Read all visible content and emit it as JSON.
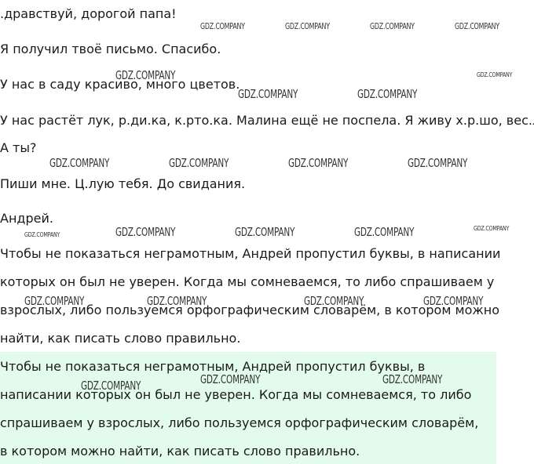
{
  "letter": {
    "greeting": ".дравствуй, дорогой папа!",
    "line1": "Я получил твоё письмо. Спасибо.",
    "line2": "У нас в саду красиво, много цветов.",
    "line3": "У нас растёт лук, р.ди.ка, к.рто.ка. Малина ещё не поспела. Я живу х.р.шо, вес.л..",
    "line4": "А ты?",
    "line5": "Пиши мне. Ц.лую тебя. До свидания.",
    "signature": "Андрей."
  },
  "question": [
    "Чтобы не показаться неграмотным, Андрей пропустил буквы, в написании",
    "которых он был не уверен. Когда мы сомневаемся, то либо спрашиваем у",
    "взрослых, либо пользуемся орфографическим словарём, в котором можно",
    "найти, как писать слово правильно."
  ],
  "answer": [
    "Чтобы не показаться неграмотным, Андрей пропустил буквы, в",
    "написании которых он был не уверен. Когда мы сомневаемся, то либо",
    "спрашиваем у взрослых, либо пользуемся орфографическим словарём,",
    "в котором можно найти, как писать слово правильно."
  ],
  "watermark": "GDZ.COMPANY",
  "colors": {
    "answer_highlight": "#e3fbeb",
    "text": "#1a1a1a"
  }
}
